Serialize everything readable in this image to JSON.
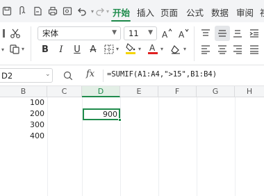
{
  "tabs": [
    {
      "label": "开始",
      "active": true
    },
    {
      "label": "插入",
      "active": false
    },
    {
      "label": "页面",
      "active": false
    },
    {
      "label": "公式",
      "active": false
    },
    {
      "label": "数据",
      "active": false
    },
    {
      "label": "审阅",
      "active": false
    },
    {
      "label": "视",
      "active": false
    }
  ],
  "font": {
    "name": "宋体",
    "size": "11"
  },
  "formula_bar": {
    "cell_ref": "D2",
    "fx": "fx",
    "formula": "=SUMIF(A1:A4,\">15\",B1:B4)"
  },
  "columns": [
    "B",
    "C",
    "D",
    "E",
    "F",
    "G",
    "H"
  ],
  "selected_column": "D",
  "cells": {
    "B1": "100",
    "B2": "200",
    "B3": "300",
    "B4": "400",
    "D2": "900"
  },
  "colors": {
    "accent": "#1f8b4c",
    "font_color_bar": "#e02020",
    "highlight_bar": "#f5d400"
  }
}
